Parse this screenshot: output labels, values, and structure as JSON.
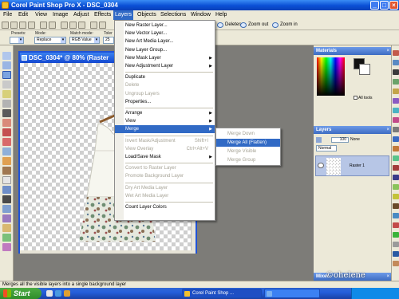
{
  "window": {
    "title": "Corel Paint Shop Pro X - DSC_0304"
  },
  "menubar": [
    "File",
    "Edit",
    "View",
    "Image",
    "Adjust",
    "Effects",
    "Layers",
    "Objects",
    "Selections",
    "Window",
    "Help"
  ],
  "toolbar": {
    "deletes_label": "Deletes",
    "zoom_out_label": "Zoom out",
    "zoom_in_label": "Zoom in"
  },
  "options": {
    "presets_label": "Presets:",
    "mode_label": "Mode:",
    "mode_value": "Replace",
    "match_label": "Match mode:",
    "match_value": "RGB Value",
    "tolerance_label": "Toler",
    "tolerance_value": "25"
  },
  "document": {
    "title": "DSC_0304*  @  80% (Raster"
  },
  "layers_menu": {
    "items": [
      {
        "label": "New Raster Layer...",
        "disabled": false,
        "arrow": false,
        "shortcut": ""
      },
      {
        "label": "New Vector Layer...",
        "disabled": false,
        "arrow": false,
        "shortcut": ""
      },
      {
        "label": "New Art Media Layer...",
        "disabled": false,
        "arrow": false,
        "shortcut": ""
      },
      {
        "label": "New Layer Group...",
        "disabled": false,
        "arrow": false,
        "shortcut": ""
      },
      {
        "label": "New Mask Layer",
        "disabled": false,
        "arrow": true,
        "shortcut": ""
      },
      {
        "label": "New Adjustment Layer",
        "disabled": false,
        "arrow": true,
        "shortcut": ""
      },
      {
        "label": "Duplicate",
        "disabled": false,
        "arrow": false,
        "shortcut": ""
      },
      {
        "label": "Delete",
        "disabled": true,
        "arrow": false,
        "shortcut": ""
      },
      {
        "label": "Ungroup Layers",
        "disabled": true,
        "arrow": false,
        "shortcut": ""
      },
      {
        "label": "Properties...",
        "disabled": false,
        "arrow": false,
        "shortcut": ""
      },
      {
        "label": "Arrange",
        "disabled": false,
        "arrow": true,
        "shortcut": ""
      },
      {
        "label": "View",
        "disabled": false,
        "arrow": true,
        "shortcut": ""
      },
      {
        "label": "Merge",
        "disabled": false,
        "arrow": true,
        "shortcut": "",
        "highlighted": true
      },
      {
        "label": "Invert Mask/Adjustment",
        "disabled": true,
        "arrow": false,
        "shortcut": "Shift+I"
      },
      {
        "label": "View Overlay",
        "disabled": true,
        "arrow": false,
        "shortcut": "Ctrl+Alt+V"
      },
      {
        "label": "Load/Save Mask",
        "disabled": false,
        "arrow": true,
        "shortcut": ""
      },
      {
        "label": "Convert to Raster Layer",
        "disabled": true,
        "arrow": false,
        "shortcut": ""
      },
      {
        "label": "Promote Background Layer",
        "disabled": true,
        "arrow": false,
        "shortcut": ""
      },
      {
        "label": "Dry Art Media Layer",
        "disabled": true,
        "arrow": false,
        "shortcut": ""
      },
      {
        "label": "Wet Art Media Layer",
        "disabled": true,
        "arrow": false,
        "shortcut": ""
      },
      {
        "label": "Count Layer Colors",
        "disabled": false,
        "arrow": false,
        "shortcut": ""
      }
    ]
  },
  "merge_submenu": {
    "items": [
      {
        "label": "Merge Down",
        "disabled": true
      },
      {
        "label": "Merge All (Flatten)",
        "disabled": false,
        "highlighted": true
      },
      {
        "label": "Merge Visible",
        "disabled": true
      },
      {
        "label": "Merge Group",
        "disabled": true
      }
    ]
  },
  "panels": {
    "materials_title": "Materials",
    "all_tools_label": "All tools",
    "layers_title": "Layers",
    "opacity_value": "100",
    "blend_none_label": "None",
    "blend_mode_value": "Normal",
    "layer_name": "Raster 1",
    "mixer_title": "Mixer"
  },
  "statusbar": {
    "text": "Merges all the visible layers into a single background layer"
  },
  "taskbar": {
    "start_label": "Start",
    "task1_label": "Corel Paint Shop ...",
    "task2_label": ""
  },
  "watermark": "©ohelene"
}
